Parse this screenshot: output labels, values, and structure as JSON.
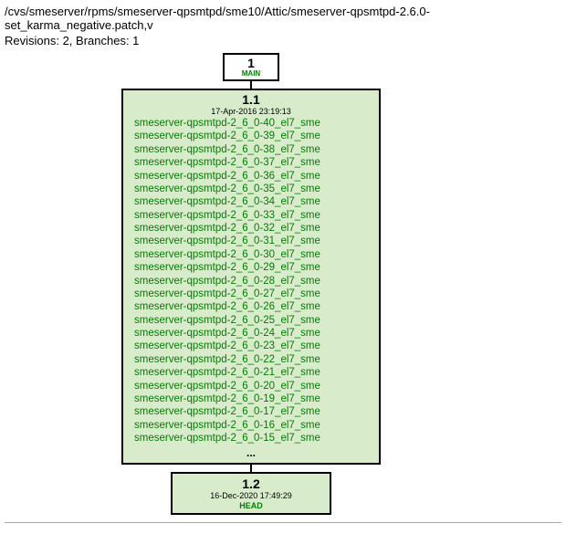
{
  "header": {
    "path": "/cvs/smeserver/rpms/smeserver-qpsmtpd/sme10/Attic/smeserver-qpsmtpd-2.6.0-set_karma_negative.patch,v",
    "revisions_line": "Revisions: 2, Branches: 1"
  },
  "branch": {
    "number": "1",
    "label": "MAIN"
  },
  "rev1": {
    "number": "1.1",
    "date": "17-Apr-2016 23:19:13",
    "tags": [
      "smeserver-qpsmtpd-2_6_0-40_el7_sme",
      "smeserver-qpsmtpd-2_6_0-39_el7_sme",
      "smeserver-qpsmtpd-2_6_0-38_el7_sme",
      "smeserver-qpsmtpd-2_6_0-37_el7_sme",
      "smeserver-qpsmtpd-2_6_0-36_el7_sme",
      "smeserver-qpsmtpd-2_6_0-35_el7_sme",
      "smeserver-qpsmtpd-2_6_0-34_el7_sme",
      "smeserver-qpsmtpd-2_6_0-33_el7_sme",
      "smeserver-qpsmtpd-2_6_0-32_el7_sme",
      "smeserver-qpsmtpd-2_6_0-31_el7_sme",
      "smeserver-qpsmtpd-2_6_0-30_el7_sme",
      "smeserver-qpsmtpd-2_6_0-29_el7_sme",
      "smeserver-qpsmtpd-2_6_0-28_el7_sme",
      "smeserver-qpsmtpd-2_6_0-27_el7_sme",
      "smeserver-qpsmtpd-2_6_0-26_el7_sme",
      "smeserver-qpsmtpd-2_6_0-25_el7_sme",
      "smeserver-qpsmtpd-2_6_0-24_el7_sme",
      "smeserver-qpsmtpd-2_6_0-23_el7_sme",
      "smeserver-qpsmtpd-2_6_0-22_el7_sme",
      "smeserver-qpsmtpd-2_6_0-21_el7_sme",
      "smeserver-qpsmtpd-2_6_0-20_el7_sme",
      "smeserver-qpsmtpd-2_6_0-19_el7_sme",
      "smeserver-qpsmtpd-2_6_0-17_el7_sme",
      "smeserver-qpsmtpd-2_6_0-16_el7_sme",
      "smeserver-qpsmtpd-2_6_0-15_el7_sme"
    ],
    "ellipsis": "..."
  },
  "rev2": {
    "number": "1.2",
    "date": "16-Dec-2020 17:49:29",
    "head": "HEAD"
  }
}
